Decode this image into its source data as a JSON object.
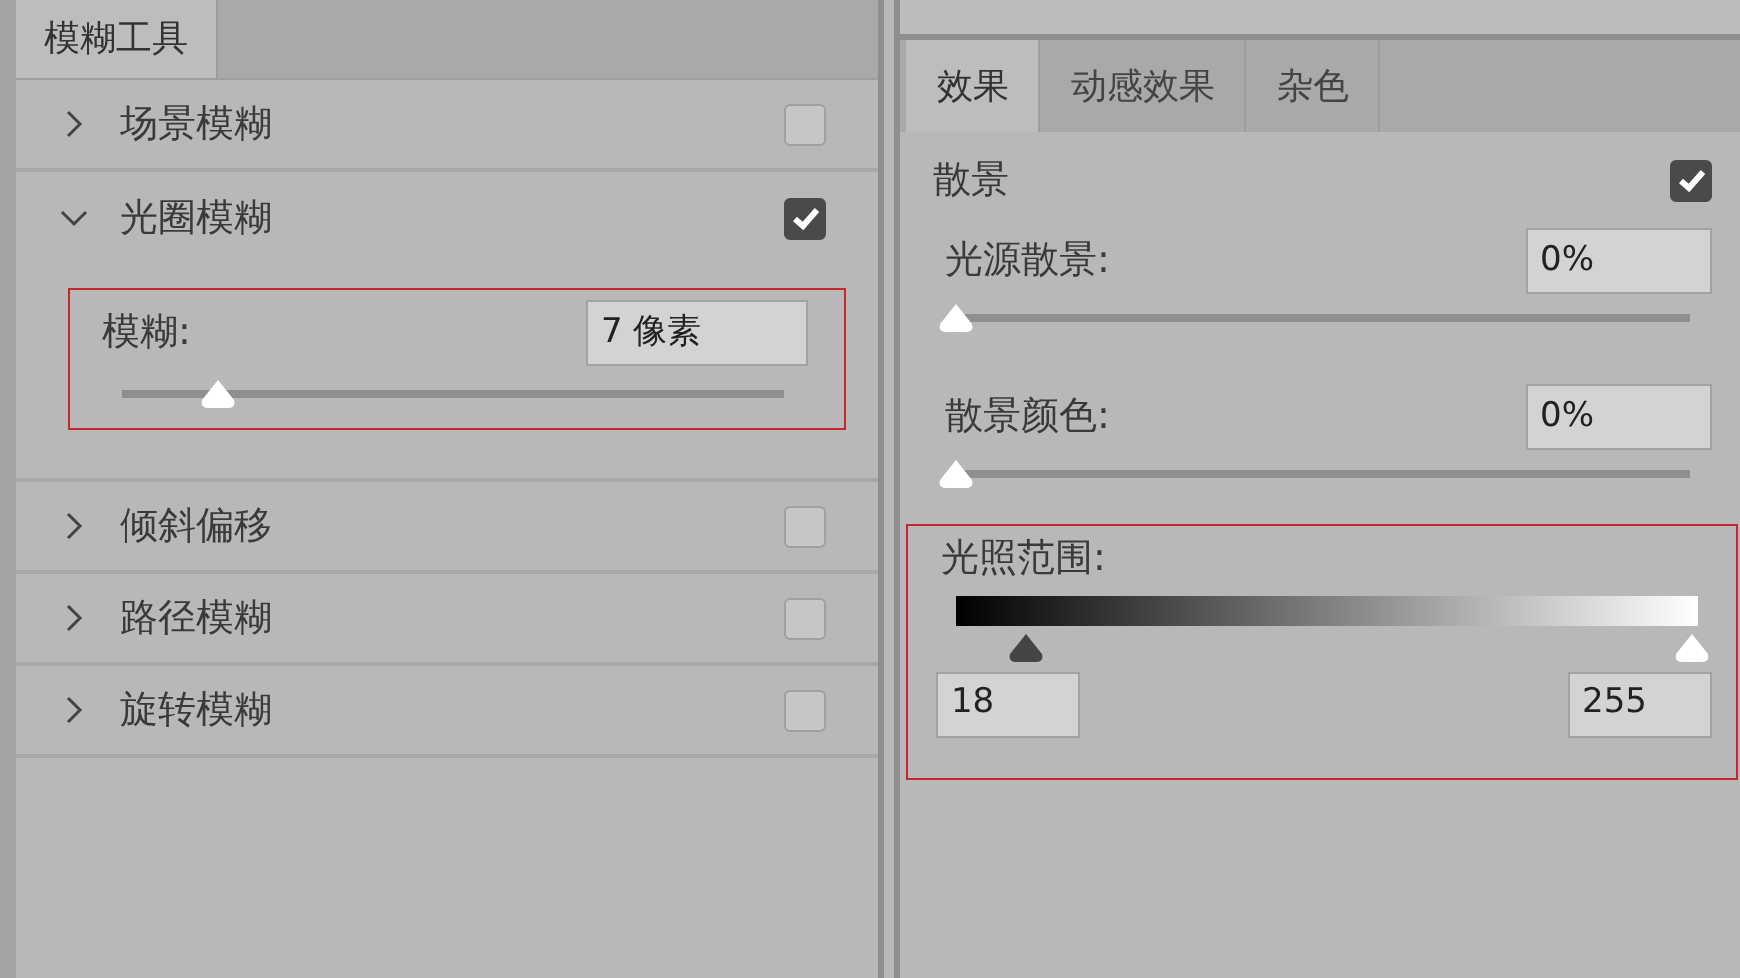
{
  "left_panel": {
    "tabs": [
      {
        "label": "模糊工具",
        "selected": true
      }
    ],
    "items": [
      {
        "label": "场景模糊",
        "expanded": false,
        "checked": false
      },
      {
        "label": "光圈模糊",
        "expanded": true,
        "checked": true,
        "settings": {
          "highlighted": true,
          "label": "模糊:",
          "value": "7 像素",
          "level": 0.145
        }
      },
      {
        "label": "倾斜偏移",
        "expanded": false,
        "checked": false
      },
      {
        "label": "路径模糊",
        "expanded": false,
        "checked": false
      },
      {
        "label": "旋转模糊",
        "expanded": false,
        "checked": false
      }
    ]
  },
  "right_panel": {
    "tabs": [
      {
        "label": "效果",
        "selected": true
      },
      {
        "label": "动感效果",
        "selected": false
      },
      {
        "label": "杂色",
        "selected": false
      }
    ],
    "bokeh": {
      "label": "散景",
      "checked": true
    },
    "sliders": [
      {
        "label": "光源散景:",
        "value": "0%",
        "level": 0
      },
      {
        "label": "散景颜色:",
        "value": "0%",
        "level": 0
      }
    ],
    "light_range": {
      "highlighted": true,
      "label": "光照范围:",
      "thumbs": [
        {
          "kind": "dark",
          "level": 0.07
        },
        {
          "kind": "light",
          "level": 1
        }
      ],
      "values": [
        "18",
        "255"
      ]
    }
  }
}
